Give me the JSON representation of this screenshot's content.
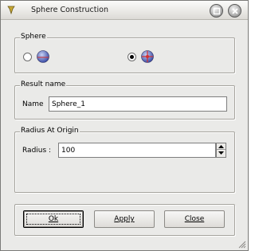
{
  "window": {
    "title": "Sphere Construction",
    "icons": {
      "app": "pin-icon",
      "maximize": "maximize-icon",
      "close": "close-icon"
    }
  },
  "sphere_group": {
    "legend": "Sphere",
    "options": [
      {
        "icon": "sphere-radius-icon",
        "selected": false
      },
      {
        "icon": "sphere-center-point-icon",
        "selected": true
      }
    ]
  },
  "result_group": {
    "legend": "Result name",
    "name_label": "Name",
    "name_value": "Sphere_1"
  },
  "radius_group": {
    "legend": "Radius At Origin",
    "radius_label": "Radius :",
    "radius_value": "100"
  },
  "buttons": {
    "ok": "Ok",
    "apply": "Apply",
    "close": "Close"
  },
  "colors": {
    "window_bg": "#eaeae8",
    "sphere_blue": "#5a6fc4",
    "sphere_red": "#d43030"
  }
}
